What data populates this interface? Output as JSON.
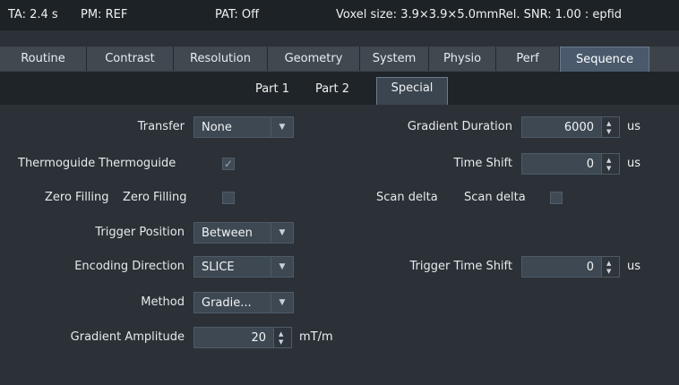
{
  "status": {
    "ta": "TA: 2.4 s",
    "pm": "PM: REF",
    "pat": "PAT: Off",
    "voxel": "Voxel size: 3.9×3.9×5.0mmRel. SNR: 1.00 : epfid"
  },
  "tabs": [
    "Routine",
    "Contrast",
    "Resolution",
    "Geometry",
    "System",
    "Physio",
    "Perf",
    "Sequence"
  ],
  "subtabs": [
    "Part 1",
    "Part 2",
    "Special"
  ],
  "left": {
    "transfer_label": "Transfer",
    "transfer_value": "None",
    "thermoguide_label": "Thermoguide",
    "thermoguide_caption": "Thermoguide",
    "zerofill_label": "Zero Filling",
    "zerofill_caption": "Zero Filling",
    "trigger_position_label": "Trigger Position",
    "trigger_position_value": "Between",
    "encoding_direction_label": "Encoding Direction",
    "encoding_direction_value": "SLICE",
    "method_label": "Method",
    "method_value": "Gradie...",
    "gradient_amplitude_label": "Gradient Amplitude",
    "gradient_amplitude_value": "20",
    "gradient_amplitude_unit": "mT/m"
  },
  "right": {
    "gradient_duration_label": "Gradient Duration",
    "gradient_duration_value": "6000",
    "gradient_duration_unit": "us",
    "time_shift_label": "Time Shift",
    "time_shift_value": "0",
    "time_shift_unit": "us",
    "scan_delta_label": "Scan delta",
    "scan_delta_caption": "Scan delta",
    "trigger_time_shift_label": "Trigger Time Shift",
    "trigger_time_shift_value": "0",
    "trigger_time_shift_unit": "us"
  },
  "icons": {
    "dropdown": "triangle-down-icon",
    "spinner": "up-down-spinner-icon",
    "checkmark": "check-icon"
  },
  "colors": {
    "active_tab": "#4a5a6c",
    "background": "#2b3137"
  }
}
